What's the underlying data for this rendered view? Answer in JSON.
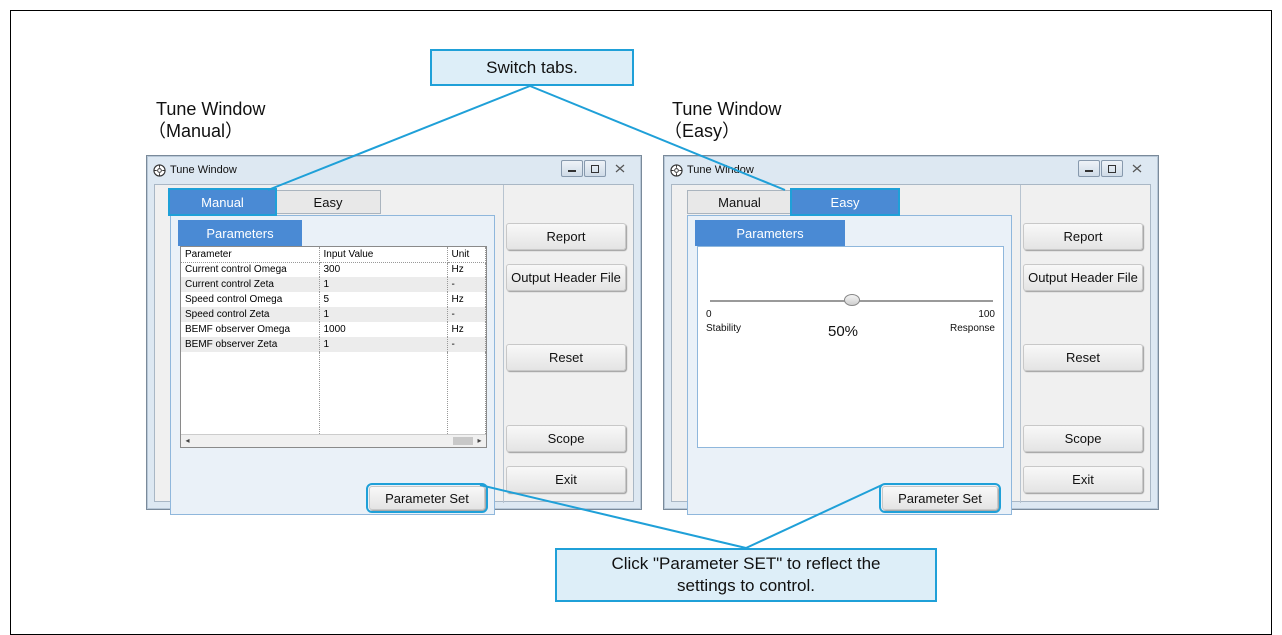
{
  "callouts": {
    "switch_tabs": "Switch tabs.",
    "param_set_line1": "Click \"Parameter SET\" to reflect the",
    "param_set_line2": "settings to control."
  },
  "captions": {
    "manual_line1": "Tune Window",
    "manual_line2": "（Manual）",
    "easy_line1": "Tune Window",
    "easy_line2": "（Easy）"
  },
  "window_manual": {
    "title": "Tune Window",
    "tabs": [
      "Manual",
      "Easy"
    ],
    "active_tab": "Manual",
    "subtab": "Parameters",
    "table": {
      "headers": [
        "Parameter",
        "Input Value",
        "Unit"
      ],
      "rows": [
        [
          "Current control Omega",
          "300",
          "Hz"
        ],
        [
          "Current control Zeta",
          "1",
          "-"
        ],
        [
          "Speed control Omega",
          "5",
          "Hz"
        ],
        [
          "Speed control Zeta",
          "1",
          "-"
        ],
        [
          "BEMF observer Omega",
          "1000",
          "Hz"
        ],
        [
          "BEMF observer Zeta",
          "1",
          "-"
        ]
      ]
    },
    "buttons": {
      "report": "Report",
      "output_header": "Output Header File",
      "reset": "Reset",
      "scope": "Scope",
      "exit": "Exit",
      "parameter_set": "Parameter Set"
    }
  },
  "window_easy": {
    "title": "Tune Window",
    "tabs": [
      "Manual",
      "Easy"
    ],
    "active_tab": "Easy",
    "subtab": "Parameters",
    "slider": {
      "min_label": "0",
      "max_label": "100",
      "left_label": "Stability",
      "right_label": "Response",
      "value_text": "50%",
      "value": 50
    },
    "buttons": {
      "report": "Report",
      "output_header": "Output Header File",
      "reset": "Reset",
      "scope": "Scope",
      "exit": "Exit",
      "parameter_set": "Parameter Set"
    }
  },
  "colors": {
    "accent": "#4a8ad4",
    "callout_border": "#1fa0d8",
    "callout_fill": "#ddeef8"
  }
}
